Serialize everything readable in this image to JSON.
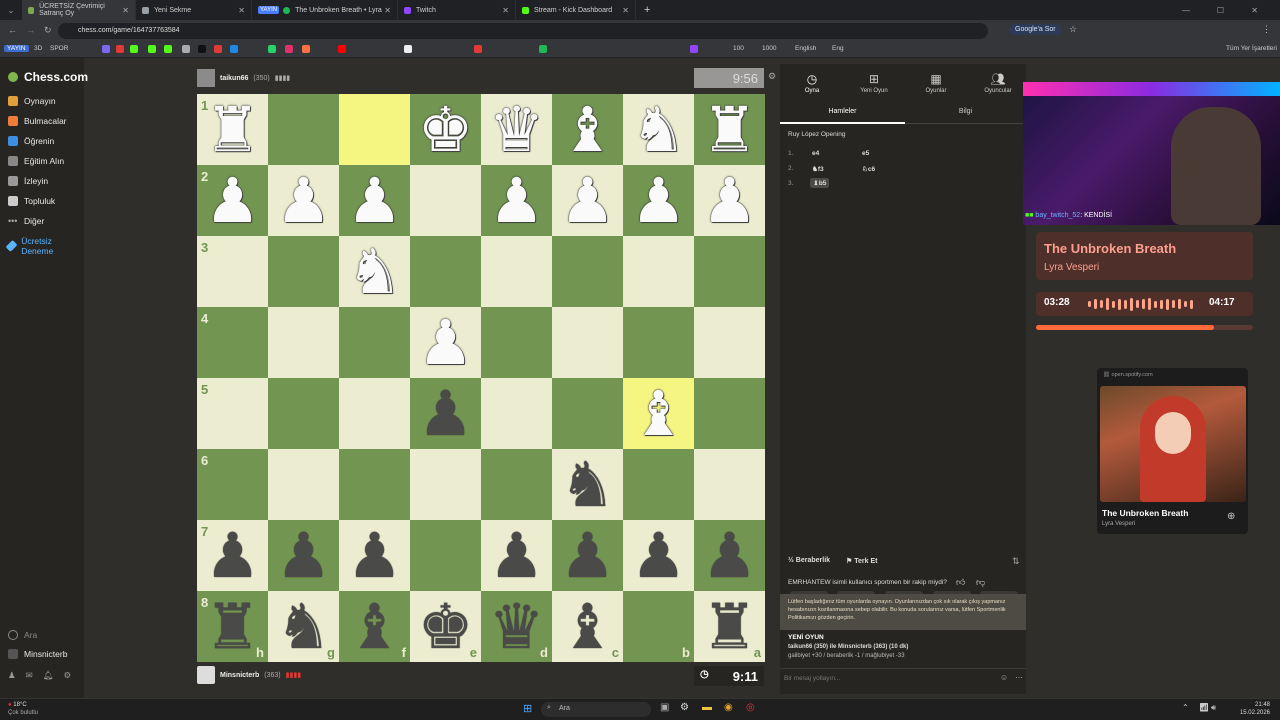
{
  "browser": {
    "tabs": [
      {
        "label": "ÜCRETSİZ Çevrimiçi Satranç Oy",
        "color": "#7fa650"
      },
      {
        "label": "Yeni Sekme",
        "color": "#9aa0a6"
      },
      {
        "label": "The Unbroken Breath • Lyra",
        "color": "#1db954"
      },
      {
        "label": "Twitch",
        "color": "#9146ff"
      },
      {
        "label": "Stream - Kick Dashboard",
        "color": "#53fc18"
      }
    ],
    "tab_badge": "YAYIN",
    "url": "chess.com/game/164737763584",
    "search_btn": "Google'a Sor",
    "bookmarks_all": "Tüm Yer İşaretleri",
    "bm_labels": [
      "YAYIN",
      "3D",
      "SPOR",
      "English",
      "Eng",
      "100",
      "1000"
    ]
  },
  "sidebar": {
    "logo": "Chess.com",
    "items": [
      "Oynayın",
      "Bulmacalar",
      "Öğrenin",
      "Eğitim Alın",
      "İzleyin",
      "Topluluk",
      "Diğer",
      "Ücretsiz Deneme"
    ],
    "search": "Ara",
    "user": "Minsnicterb"
  },
  "top_player": {
    "name": "taikun66",
    "rating": "(350)",
    "clock": "9:56"
  },
  "bottom_player": {
    "name": "Minsnicterb",
    "rating": "(363)",
    "clock": "9:11"
  },
  "board": {
    "ranks": [
      "1",
      "2",
      "3",
      "4",
      "5",
      "6",
      "7",
      "8"
    ],
    "files": [
      "h",
      "g",
      "f",
      "e",
      "d",
      "c",
      "b",
      "a"
    ],
    "rows": [
      [
        "wR",
        "",
        "",
        "wK",
        "wQ",
        "wB",
        "wN",
        "wR"
      ],
      [
        "wP",
        "wP",
        "wP",
        "",
        "wP",
        "wP",
        "wP",
        "wP"
      ],
      [
        "",
        "",
        "wN",
        "",
        "",
        "",
        "",
        ""
      ],
      [
        "",
        "",
        "",
        "wP",
        "",
        "",
        "",
        ""
      ],
      [
        "",
        "",
        "",
        "bP",
        "",
        "",
        "wB",
        ""
      ],
      [
        "",
        "",
        "",
        "",
        "",
        "bN",
        "",
        ""
      ],
      [
        "bP",
        "bP",
        "bP",
        "",
        "bP",
        "bP",
        "bP",
        "bP"
      ],
      [
        "bR",
        "bN",
        "bB",
        "bK",
        "bQ",
        "bB",
        "",
        "bR"
      ]
    ],
    "highlight": [
      [
        0,
        2
      ],
      [
        4,
        6
      ]
    ]
  },
  "panel": {
    "tabs": [
      "Oyna",
      "Yeni Oyun",
      "Oyunlar",
      "Oyuncular"
    ],
    "subtabs": [
      "Hamleler",
      "Bilgi"
    ],
    "opening": "Ruy López Opening",
    "moves": [
      {
        "n": "1.",
        "w": "e4",
        "b": "e5"
      },
      {
        "n": "2.",
        "w": "f3",
        "b": "c6"
      },
      {
        "n": "3.",
        "w": "b5",
        "b": ""
      }
    ],
    "draw": "Beraberlik",
    "resign": "Terk Et",
    "question": "EMRHANTEW isimli kullanıcı sportmen bir rakip miydi?",
    "notice": "Lütfen başladığınız tüm oyunlarda oynayın. Oyunlarınızdan çok sık olarak çıkış yapmanız hesabınızın kısıtlanmasına sebep olabilir. Bu konuda sorularınız varsa, lütfen Sportmenlik Politikamızı gözden geçirin.",
    "newgame_title": "YENİ OYUN",
    "newgame_line1": "taikun66 (350) ile Minsnicterb (363) (10 dk)",
    "newgame_line2": "galibiyet +30 / beraberlik -1 / mağlubiyet -33",
    "chat_placeholder": "Bir mesaj yollayın..."
  },
  "overlay": {
    "cam_user": "bay_twitch_52",
    "cam_suffix": ": KENDİSİ",
    "song": "The Unbroken Breath",
    "artist": "Lyra Vesperi",
    "time_now": "03:28",
    "time_total": "04:17",
    "progress": 0.82,
    "spotify_url": "open.spotify.com",
    "spotify_song": "The Unbroken Breath",
    "spotify_artist": "Lyra Vesperi"
  },
  "taskbar": {
    "weather": "18°C",
    "weather_desc": "Çok bulutlu",
    "search": "Ara",
    "time": "21:48",
    "date": "15.02.2026"
  }
}
